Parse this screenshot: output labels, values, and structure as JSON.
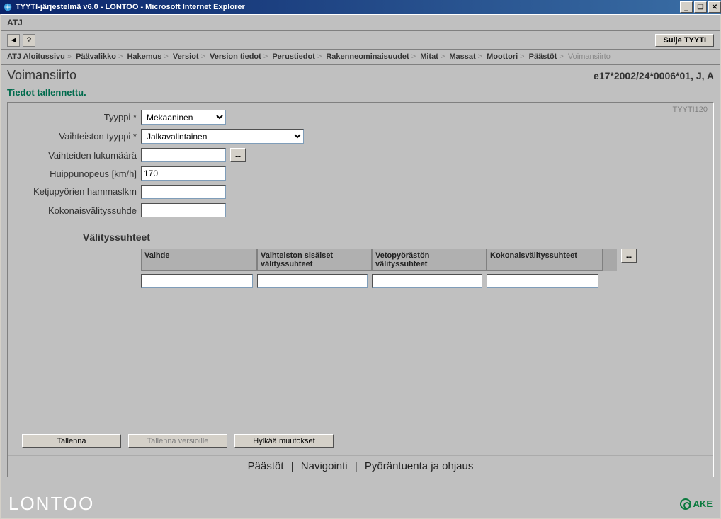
{
  "window": {
    "title": "TYYTI-järjestelmä v6.0 - LONTOO - Microsoft Internet Explorer"
  },
  "menubar": {
    "item": "ATJ"
  },
  "toolbar": {
    "back_icon": "◄",
    "help_icon": "?",
    "close_app": "Sulje TYYTI"
  },
  "breadcrumb": [
    "ATJ Aloitussivu",
    "Päävalikko",
    "Hakemus",
    "Versiot",
    "Version tiedot",
    "Perustiedot",
    "Rakenneominaisuudet",
    "Mitat",
    "Massat",
    "Moottori",
    "Päästöt",
    "Voimansiirto"
  ],
  "page": {
    "title": "Voimansiirto",
    "code": "e17*2002/24*0006*01, J, A",
    "status": "Tiedot tallennettu.",
    "panel_id": "TYYTI120"
  },
  "form": {
    "tyyppi_label": "Tyyppi *",
    "tyyppi_value": "Mekaaninen",
    "vaihteiston_label": "Vaihteiston tyyppi *",
    "vaihteiston_value": "Jalkavalintainen",
    "vaihteiden_label": "Vaihteiden lukumäärä",
    "vaihteiden_value": "",
    "huippunopeus_label": "Huippunopeus [km/h]",
    "huippunopeus_value": "170",
    "ketjupyorien_label": "Ketjupyörien hammaslkm",
    "ketjupyorien_value": "",
    "kokonais_label": "Kokonaisvälityssuhde",
    "kokonais_value": "",
    "ellipsis": "..."
  },
  "section": {
    "title": "Välityssuhteet",
    "headers": [
      "Vaihde",
      "Vaihteiston sisäiset välityssuhteet",
      "Vetopyörästön välityssuhteet",
      "Kokonaisvälityssuhteet"
    ],
    "row": [
      "",
      "",
      "",
      ""
    ],
    "ellipsis": "..."
  },
  "buttons": {
    "tallenna": "Tallenna",
    "tallenna_versioille": "Tallenna versioille",
    "hylkaa": "Hylkää muutokset"
  },
  "bottom_nav": [
    "Päästöt",
    "Navigointi",
    "Pyöräntuenta ja ohjaus"
  ],
  "footer": {
    "logo": "LONTOO",
    "ake": "AKE"
  },
  "winbtns": {
    "min": "_",
    "max": "❐",
    "close": "✕"
  }
}
